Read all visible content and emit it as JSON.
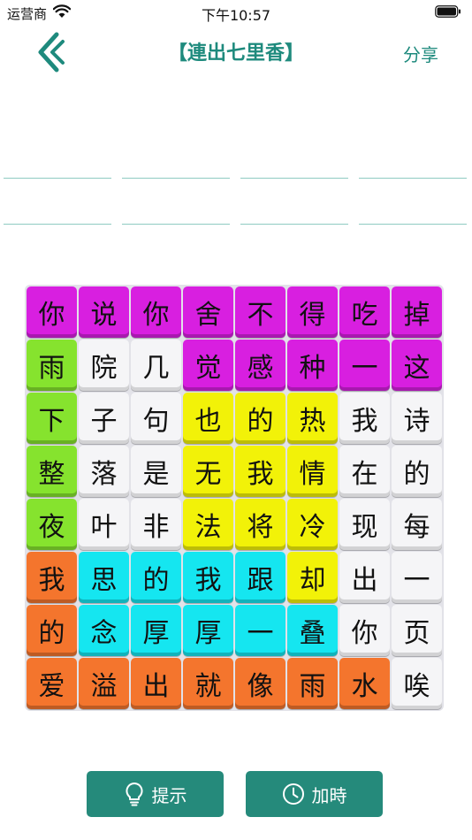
{
  "status_bar": {
    "carrier": "运营商",
    "time": "下午10:57"
  },
  "nav": {
    "title": "【連出七里香】",
    "share_label": "分享"
  },
  "answer_slots": {
    "rows": 2,
    "per_row": 4
  },
  "board": {
    "rows": [
      [
        {
          "ch": "你",
          "color": "magenta"
        },
        {
          "ch": "说",
          "color": "magenta"
        },
        {
          "ch": "你",
          "color": "magenta"
        },
        {
          "ch": "舍",
          "color": "magenta"
        },
        {
          "ch": "不",
          "color": "magenta"
        },
        {
          "ch": "得",
          "color": "magenta"
        },
        {
          "ch": "吃",
          "color": "magenta"
        },
        {
          "ch": "掉",
          "color": "magenta"
        }
      ],
      [
        {
          "ch": "雨",
          "color": "green"
        },
        {
          "ch": "院",
          "color": "white"
        },
        {
          "ch": "几",
          "color": "white"
        },
        {
          "ch": "觉",
          "color": "magenta"
        },
        {
          "ch": "感",
          "color": "magenta"
        },
        {
          "ch": "种",
          "color": "magenta"
        },
        {
          "ch": "一",
          "color": "magenta"
        },
        {
          "ch": "这",
          "color": "magenta"
        }
      ],
      [
        {
          "ch": "下",
          "color": "green"
        },
        {
          "ch": "子",
          "color": "white"
        },
        {
          "ch": "句",
          "color": "white"
        },
        {
          "ch": "也",
          "color": "yellow"
        },
        {
          "ch": "的",
          "color": "yellow"
        },
        {
          "ch": "热",
          "color": "yellow"
        },
        {
          "ch": "我",
          "color": "white"
        },
        {
          "ch": "诗",
          "color": "white"
        }
      ],
      [
        {
          "ch": "整",
          "color": "green"
        },
        {
          "ch": "落",
          "color": "white"
        },
        {
          "ch": "是",
          "color": "white"
        },
        {
          "ch": "无",
          "color": "yellow"
        },
        {
          "ch": "我",
          "color": "yellow"
        },
        {
          "ch": "情",
          "color": "yellow"
        },
        {
          "ch": "在",
          "color": "white"
        },
        {
          "ch": "的",
          "color": "white"
        }
      ],
      [
        {
          "ch": "夜",
          "color": "green"
        },
        {
          "ch": "叶",
          "color": "white"
        },
        {
          "ch": "非",
          "color": "white"
        },
        {
          "ch": "法",
          "color": "yellow"
        },
        {
          "ch": "将",
          "color": "yellow"
        },
        {
          "ch": "冷",
          "color": "yellow"
        },
        {
          "ch": "现",
          "color": "white"
        },
        {
          "ch": "每",
          "color": "white"
        }
      ],
      [
        {
          "ch": "我",
          "color": "orange"
        },
        {
          "ch": "思",
          "color": "cyan"
        },
        {
          "ch": "的",
          "color": "cyan"
        },
        {
          "ch": "我",
          "color": "cyan"
        },
        {
          "ch": "跟",
          "color": "cyan"
        },
        {
          "ch": "却",
          "color": "yellow"
        },
        {
          "ch": "出",
          "color": "white"
        },
        {
          "ch": "一",
          "color": "white"
        }
      ],
      [
        {
          "ch": "的",
          "color": "orange"
        },
        {
          "ch": "念",
          "color": "cyan"
        },
        {
          "ch": "厚",
          "color": "cyan"
        },
        {
          "ch": "厚",
          "color": "cyan"
        },
        {
          "ch": "一",
          "color": "cyan"
        },
        {
          "ch": "叠",
          "color": "cyan"
        },
        {
          "ch": "你",
          "color": "white"
        },
        {
          "ch": "页",
          "color": "white"
        }
      ],
      [
        {
          "ch": "爱",
          "color": "orange"
        },
        {
          "ch": "溢",
          "color": "orange"
        },
        {
          "ch": "出",
          "color": "orange"
        },
        {
          "ch": "就",
          "color": "orange"
        },
        {
          "ch": "像",
          "color": "orange"
        },
        {
          "ch": "雨",
          "color": "orange"
        },
        {
          "ch": "水",
          "color": "orange"
        },
        {
          "ch": "唉",
          "color": "white"
        }
      ]
    ]
  },
  "buttons": {
    "hint_label": "提示",
    "hint_icon": "lightbulb-icon",
    "time_label": "加時",
    "time_icon": "clock-icon"
  },
  "colors": {
    "accent": "#1e8a7d",
    "button_bg": "#258a7b",
    "slot_line": "#8fcbc2",
    "magenta": "#d81fe0",
    "green": "#86e32e",
    "yellow": "#f2f208",
    "cyan": "#15e6f0",
    "orange": "#f4752d",
    "white": "#f5f5f7"
  }
}
